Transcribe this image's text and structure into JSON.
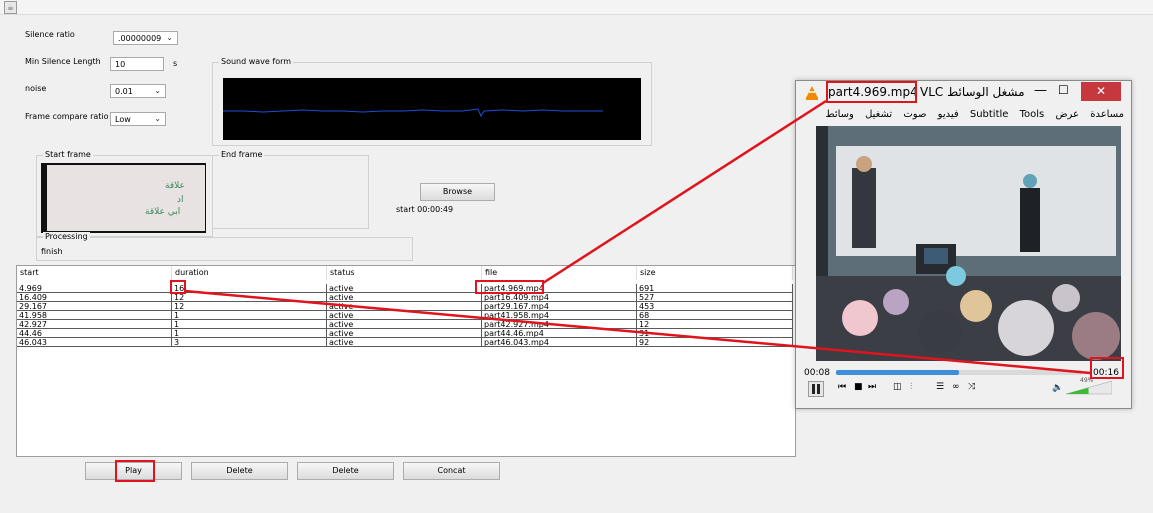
{
  "settings": {
    "silence_ratio_label": "Silence ratio",
    "silence_ratio_value": ".00000009",
    "min_silence_label": "Min Silence Length",
    "min_silence_value": "10",
    "min_silence_unit": "s",
    "noise_label": "noise",
    "noise_value": "0.01",
    "frame_compare_label": "Frame compare ratio",
    "frame_compare_value": "Low"
  },
  "sound_wave": {
    "title": "Sound wave form"
  },
  "frames": {
    "start_title": "Start frame",
    "end_title": "End frame",
    "browse_label": "Browse",
    "start_time_text": "start 00:00:49",
    "start_frame_text_1": "علاقة",
    "start_frame_text_2": "ابي علاقة",
    "start_frame_text_3": "اد"
  },
  "processing": {
    "title": "Processing",
    "status": "finish"
  },
  "table": {
    "columns": [
      "start",
      "duration",
      "status",
      "file",
      "size"
    ],
    "rows": [
      [
        "4.969",
        "16",
        "active",
        "part4.969.mp4",
        "691"
      ],
      [
        "16.409",
        "12",
        "active",
        "part16.409.mp4",
        "527"
      ],
      [
        "29.167",
        "12",
        "active",
        "part29.167.mp4",
        "453"
      ],
      [
        "41.958",
        "1",
        "active",
        "part41.958.mp4",
        "68"
      ],
      [
        "42.927",
        "1",
        "active",
        "part42.927.mp4",
        "12"
      ],
      [
        "44.46",
        "1",
        "active",
        "part44.46.mp4",
        "31"
      ],
      [
        "46.043",
        "3",
        "active",
        "part46.043.mp4",
        "92"
      ]
    ]
  },
  "buttons": {
    "play": "Play",
    "delete1": "Delete",
    "delete2": "Delete",
    "concat": "Concat"
  },
  "vlc": {
    "title_file": "part4.969.mp4",
    "title_app": "مشغل الوسائط VLC",
    "menu": [
      "مساعدة",
      "عرض",
      "Subtitle",
      "Tools",
      "فيديو",
      "صوت",
      "تشغيل",
      "وسائط"
    ],
    "elapsed": "00:08",
    "total": "00:16",
    "volume": "49%",
    "progress_fraction": 0.5,
    "volume_fraction": 0.49
  },
  "colors": {
    "highlight": "#e0141c",
    "vlc_orange": "#f08a00",
    "close_red": "#c7383e",
    "progress_blue": "#3c8fd6"
  }
}
